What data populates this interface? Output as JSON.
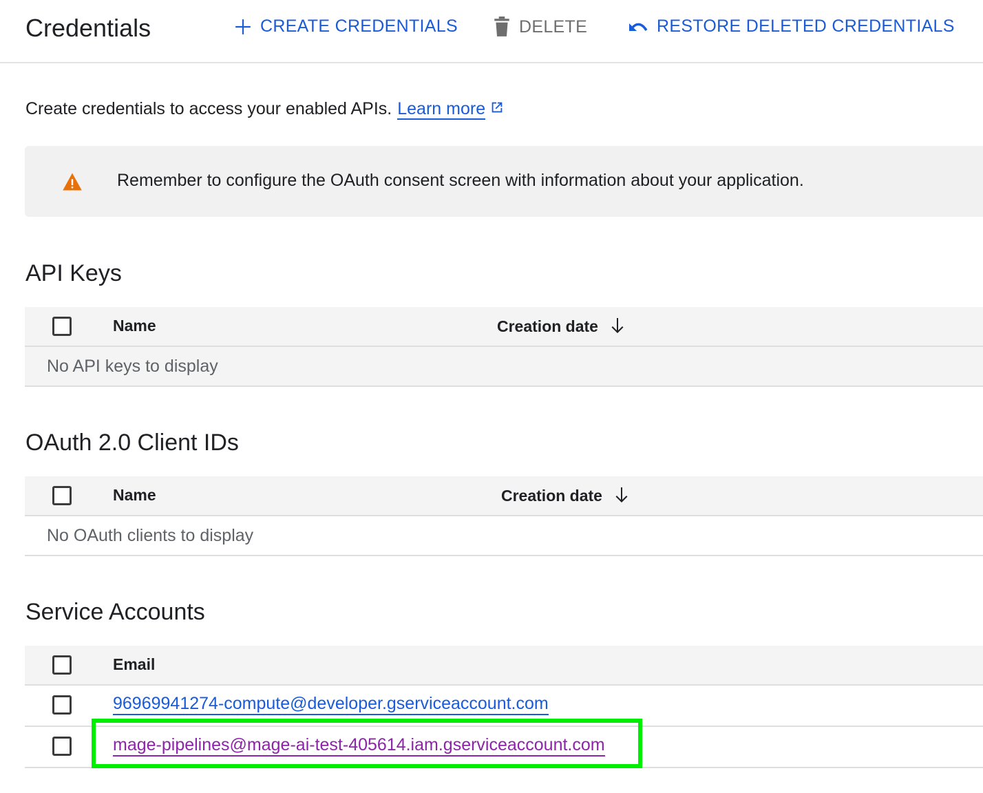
{
  "header": {
    "title": "Credentials",
    "actions": {
      "create": {
        "label": "CREATE CREDENTIALS",
        "icon": "plus-icon"
      },
      "delete": {
        "label": "DELETE",
        "icon": "trash-icon"
      },
      "restore": {
        "label": "RESTORE DELETED CREDENTIALS",
        "icon": "undo-icon"
      }
    }
  },
  "intro": {
    "text": "Create credentials to access your enabled APIs.",
    "link_label": "Learn more",
    "link_icon": "external-link-icon"
  },
  "banner": {
    "icon": "warning-icon",
    "message": "Remember to configure the OAuth consent screen with information about your application."
  },
  "api_keys": {
    "title": "API Keys",
    "columns": [
      "Name",
      "Creation date"
    ],
    "sort_icon": "arrow-down-icon",
    "empty": "No API keys to display"
  },
  "oauth": {
    "title": "OAuth 2.0 Client IDs",
    "columns": [
      "Name",
      "Creation date"
    ],
    "sort_icon": "arrow-down-icon",
    "empty": "No OAuth clients to display"
  },
  "service_accounts": {
    "title": "Service Accounts",
    "columns": [
      "Email"
    ],
    "rows": [
      {
        "email": "96969941274-compute@developer.gserviceaccount.com",
        "highlighted": false
      },
      {
        "email": "mage-pipelines@mage-ai-test-405614.iam.gserviceaccount.com",
        "highlighted": true
      }
    ]
  },
  "colors": {
    "accent": "#1a5bd8",
    "visited_link": "#8e24aa",
    "warning": "#e8710a",
    "highlight_box": "#00ee00"
  }
}
